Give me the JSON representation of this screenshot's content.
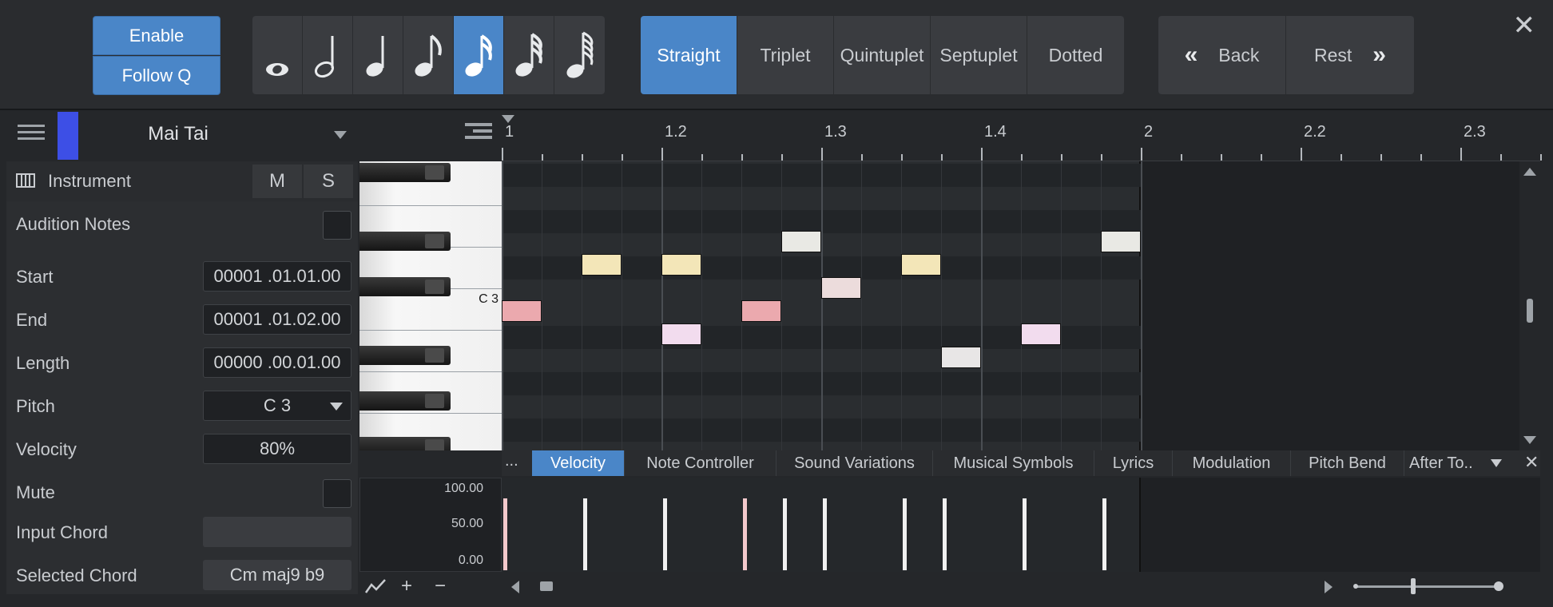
{
  "toolbar": {
    "enable_label": "Enable",
    "follow_q_label": "Follow Q",
    "note_values": [
      {
        "icon": "whole-note-icon",
        "active": false
      },
      {
        "icon": "half-note-icon",
        "active": false
      },
      {
        "icon": "quarter-note-icon",
        "active": false
      },
      {
        "icon": "eighth-note-icon",
        "active": false
      },
      {
        "icon": "sixteenth-note-icon",
        "active": true
      },
      {
        "icon": "thirty-second-note-icon",
        "active": false
      },
      {
        "icon": "sixty-fourth-note-icon",
        "active": false
      }
    ],
    "quantize_types": [
      "Straight",
      "Triplet",
      "Quintuplet",
      "Septuplet",
      "Dotted"
    ],
    "active_quantize": "Straight",
    "back_label": "Back",
    "rest_label": "Rest",
    "close_icon": "close-icon"
  },
  "track": {
    "name": "Mai Tai",
    "color": "#3d4fe6"
  },
  "ruler": {
    "labels": [
      "1",
      "1.2",
      "1.3",
      "1.4",
      "2",
      "2.2",
      "2.3"
    ]
  },
  "inspector": {
    "instrument_label": "Instrument",
    "mute_label": "M",
    "solo_label": "S",
    "audition_label": "Audition Notes",
    "start_label": "Start",
    "start_value": "00001 .01.01.00",
    "end_label": "End",
    "end_value": "00001 .01.02.00",
    "length_label": "Length",
    "length_value": "00000 .00.01.00",
    "pitch_label": "Pitch",
    "pitch_value": "C 3",
    "velocity_label": "Velocity",
    "velocity_value": "80%",
    "mute_row_label": "Mute",
    "input_chord_label": "Input Chord",
    "input_chord_value": "",
    "selected_chord_label": "Selected Chord",
    "selected_chord_value": "Cm maj9 b9"
  },
  "piano": {
    "c3_label": "C 3"
  },
  "notes": [
    {
      "start": 0,
      "pitch_row": 6,
      "color": "#eba9ae"
    },
    {
      "start": 2,
      "pitch_row": 4,
      "color": "#f3e6b8"
    },
    {
      "start": 4,
      "pitch_row": 4,
      "color": "#f3e6b8"
    },
    {
      "start": 4,
      "pitch_row": 7,
      "color": "#f2dcee"
    },
    {
      "start": 6,
      "pitch_row": 6,
      "color": "#eba9ae"
    },
    {
      "start": 7,
      "pitch_row": 3,
      "color": "#e9e9e4"
    },
    {
      "start": 8,
      "pitch_row": 5,
      "color": "#ecdcdc"
    },
    {
      "start": 10,
      "pitch_row": 4,
      "color": "#f3e6b8"
    },
    {
      "start": 11,
      "pitch_row": 8,
      "color": "#e8e6e6"
    },
    {
      "start": 13,
      "pitch_row": 7,
      "color": "#f2dcee"
    },
    {
      "start": 15,
      "pitch_row": 3,
      "color": "#e9e9e4"
    }
  ],
  "controller": {
    "more_label": "...",
    "tabs": [
      "Velocity",
      "Note Controller",
      "Sound Variations",
      "Musical Symbols",
      "Lyrics",
      "Modulation",
      "Pitch Bend",
      "After To.."
    ],
    "active_tab": "Velocity",
    "scale_labels": [
      "100.00",
      "50.00",
      "0.00"
    ],
    "velocities": [
      0.8,
      0.8,
      0.8,
      0.8,
      0.8,
      0.8,
      0.8,
      0.8,
      0.8,
      0.8
    ]
  },
  "bottom": {
    "line_tool_icon": "line-tool-icon",
    "add_icon": "+",
    "remove_icon": "−"
  }
}
